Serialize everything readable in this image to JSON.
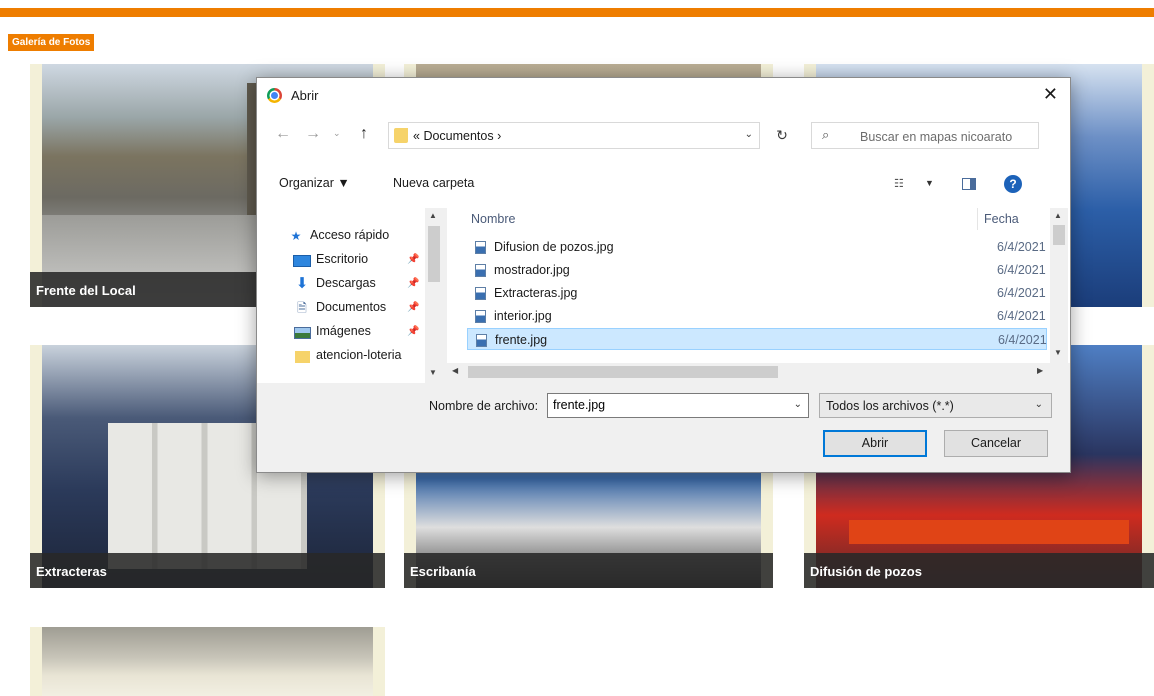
{
  "site": {
    "gallery_label": "Galería de Fotos",
    "tiles": [
      {
        "caption": "Frente del Local"
      },
      {
        "caption": ""
      },
      {
        "caption": ""
      },
      {
        "caption": "Extracteras"
      },
      {
        "caption": "Escribanía"
      },
      {
        "caption": "Difusión de pozos"
      },
      {
        "caption": ""
      }
    ],
    "accent_color": "#ee7d00"
  },
  "dialog": {
    "title": "Abrir",
    "address": {
      "path_prefix": "«",
      "folder": "Documentos",
      "separator": "›"
    },
    "search_placeholder": "Buscar en mapas nicoarato",
    "toolbar": {
      "organize": "Organizar ▼",
      "new_folder": "Nueva carpeta"
    },
    "nav_items": [
      {
        "label": "Acceso rápido",
        "icon": "star-icon"
      },
      {
        "label": "Escritorio",
        "icon": "desktop-icon"
      },
      {
        "label": "Descargas",
        "icon": "download-icon"
      },
      {
        "label": "Documentos",
        "icon": "document-icon"
      },
      {
        "label": "Imágenes",
        "icon": "image-icon"
      },
      {
        "label": "atencion-loteria",
        "icon": "folder-icon"
      }
    ],
    "columns": {
      "name": "Nombre",
      "date": "Fecha"
    },
    "files": [
      {
        "name": "Difusion de pozos.jpg",
        "date": "6/4/2021",
        "selected": false
      },
      {
        "name": "mostrador.jpg",
        "date": "6/4/2021",
        "selected": false
      },
      {
        "name": "Extracteras.jpg",
        "date": "6/4/2021",
        "selected": false
      },
      {
        "name": "interior.jpg",
        "date": "6/4/2021",
        "selected": false
      },
      {
        "name": "frente.jpg",
        "date": "6/4/2021",
        "selected": true
      }
    ],
    "filename_label": "Nombre de archivo:",
    "filename_value": "frente.jpg",
    "filter_value": "Todos los archivos (*.*)",
    "buttons": {
      "open": "Abrir",
      "cancel": "Cancelar"
    }
  }
}
